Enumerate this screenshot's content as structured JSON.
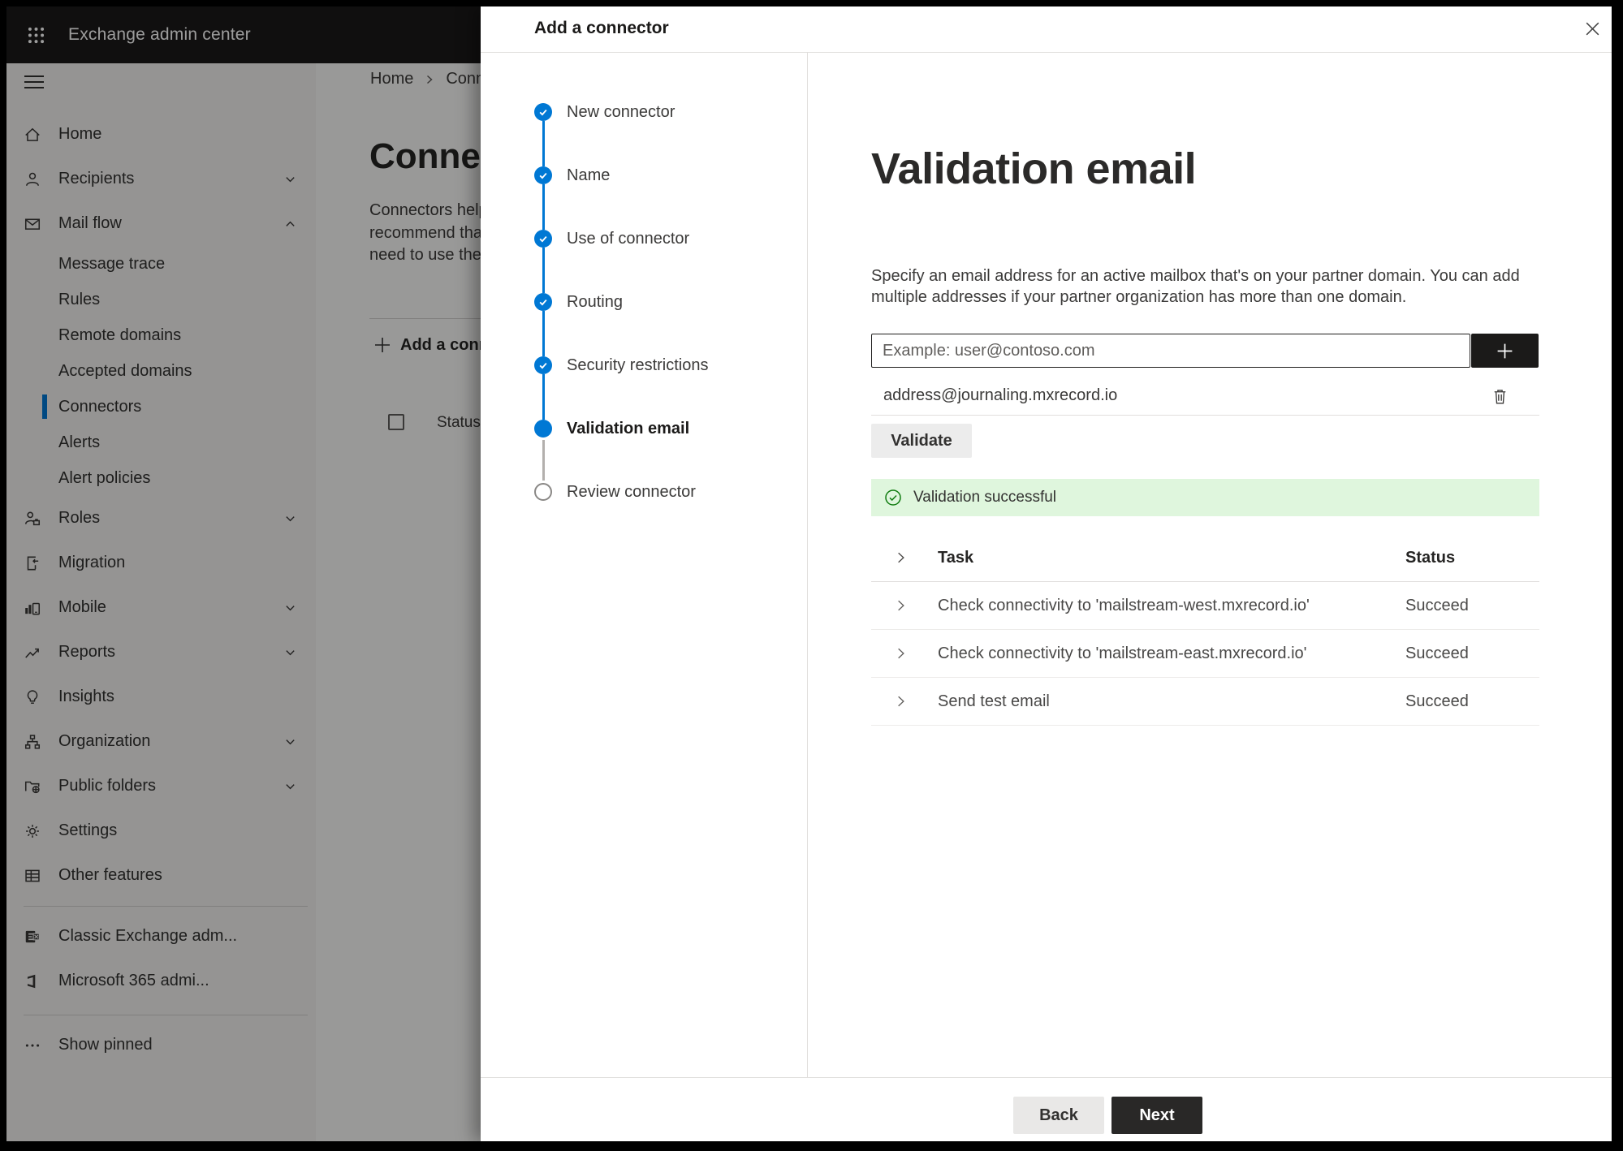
{
  "topbar": {
    "title": "Exchange admin center"
  },
  "sidebar": {
    "items": [
      {
        "label": "Home"
      },
      {
        "label": "Recipients"
      },
      {
        "label": "Mail flow"
      },
      {
        "label": "Message trace"
      },
      {
        "label": "Rules"
      },
      {
        "label": "Remote domains"
      },
      {
        "label": "Accepted domains"
      },
      {
        "label": "Connectors",
        "selected": true
      },
      {
        "label": "Alerts"
      },
      {
        "label": "Alert policies"
      },
      {
        "label": "Roles"
      },
      {
        "label": "Migration"
      },
      {
        "label": "Mobile"
      },
      {
        "label": "Reports"
      },
      {
        "label": "Insights"
      },
      {
        "label": "Organization"
      },
      {
        "label": "Public folders"
      },
      {
        "label": "Settings"
      },
      {
        "label": "Other features"
      },
      {
        "label": "Classic Exchange adm..."
      },
      {
        "label": "Microsoft 365 admi..."
      },
      {
        "label": "Show pinned"
      }
    ]
  },
  "page_behind": {
    "breadcrumb": [
      "Home",
      "Conne"
    ],
    "title": "Connec",
    "paragraph_lines": [
      "Connectors help",
      "recommend tha",
      "need to use ther"
    ],
    "add_button": "Add a conn",
    "status_header": "Status"
  },
  "modal": {
    "title": "Add a connector",
    "steps": [
      {
        "label": "New connector",
        "state": "done"
      },
      {
        "label": "Name",
        "state": "done"
      },
      {
        "label": "Use of connector",
        "state": "done"
      },
      {
        "label": "Routing",
        "state": "done"
      },
      {
        "label": "Security restrictions",
        "state": "done"
      },
      {
        "label": "Validation email",
        "state": "current"
      },
      {
        "label": "Review connector",
        "state": "upcoming"
      }
    ],
    "content": {
      "heading": "Validation email",
      "description_lines": [
        "Specify an email address for an active mailbox that's on your partner domain. You can add",
        "multiple addresses if your partner organization has more than one domain."
      ],
      "email_input": {
        "placeholder": "Example: user@contoso.com",
        "value": ""
      },
      "added_address": "address@journaling.mxrecord.io",
      "validate_button": "Validate",
      "success_message": "Validation successful",
      "table": {
        "task_header": "Task",
        "status_header": "Status",
        "rows": [
          {
            "task": "Check connectivity to 'mailstream-west.mxrecord.io'",
            "status": "Succeed"
          },
          {
            "task": "Check connectivity to 'mailstream-east.mxrecord.io'",
            "status": "Succeed"
          },
          {
            "task": "Send test email",
            "status": "Succeed"
          }
        ]
      }
    },
    "footer": {
      "back": "Back",
      "next": "Next"
    }
  },
  "colors": {
    "accent": "#0078d4",
    "success_bg": "#dff6dd",
    "success_icon": "#107c10",
    "topbar_bg": "#1b1a19",
    "primary_button_bg": "#292827"
  }
}
